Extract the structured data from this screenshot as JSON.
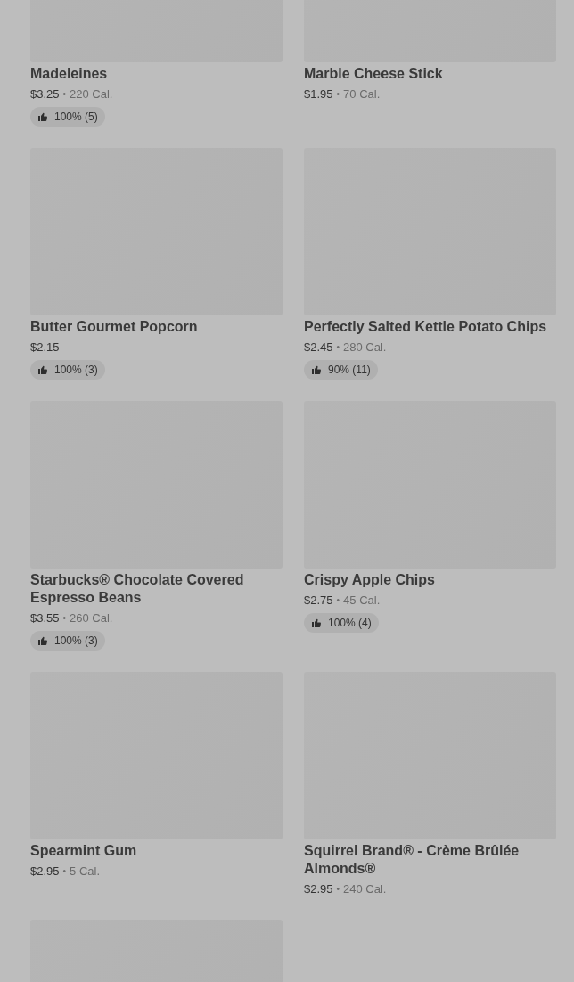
{
  "products": [
    {
      "kind": "card",
      "name": "Madeleines",
      "price": "$3.25",
      "separator": "•",
      "calories": "220 Cal.",
      "rating": "100% (5)"
    },
    {
      "kind": "card",
      "name": "Marble Cheese Stick",
      "price": "$1.95",
      "separator": "•",
      "calories": "70 Cal."
    },
    {
      "kind": "card",
      "name": "Butter Gourmet Popcorn",
      "price": "$2.15",
      "rating": "100% (3)"
    },
    {
      "kind": "card",
      "name": "Perfectly Salted Kettle Potato Chips",
      "price": "$2.45",
      "separator": "•",
      "calories": "280 Cal.",
      "rating": "90% (11)"
    },
    {
      "kind": "card",
      "name": "Starbucks® Chocolate Covered Espresso Beans",
      "price": "$3.55",
      "separator": "•",
      "calories": "260 Cal.",
      "rating": "100% (3)"
    },
    {
      "kind": "card",
      "name": "Crispy Apple Chips",
      "price": "$2.75",
      "separator": "•",
      "calories": "45 Cal.",
      "rating": "100% (4)"
    },
    {
      "kind": "card",
      "name": "Spearmint Gum",
      "price": "$2.95",
      "separator": "•",
      "calories": "5 Cal."
    },
    {
      "kind": "card",
      "name": "Squirrel Brand® - Crème Brûlée Almonds®",
      "price": "$2.95",
      "separator": "•",
      "calories": "240 Cal."
    },
    {
      "kind": "image_only"
    }
  ]
}
